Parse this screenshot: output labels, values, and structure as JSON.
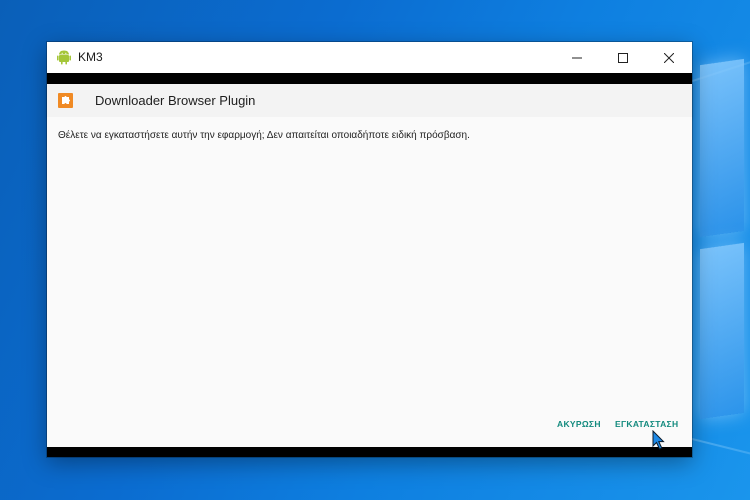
{
  "window": {
    "title": "KM3",
    "app_icon": "android-icon",
    "controls": [
      "minimize-icon",
      "maximize-icon",
      "close-icon"
    ]
  },
  "app": {
    "title": "Downloader Browser Plugin",
    "icon": "plugin-icon"
  },
  "dialog": {
    "message": "Θέλετε να εγκαταστήσετε αυτήν την εφαρμογή; Δεν απαιτείται οποιαδήποτε ειδική πρόσβαση.",
    "cancel_label": "ΑΚΥΡΩΣΗ",
    "install_label": "ΕΓΚΑΤΑΣΤΑΣΗ"
  },
  "colors": {
    "accent": "#138a7e",
    "plugin_icon": "#f08a24",
    "android_green": "#a4c639",
    "desktop_blue": "#0b6cd0"
  }
}
